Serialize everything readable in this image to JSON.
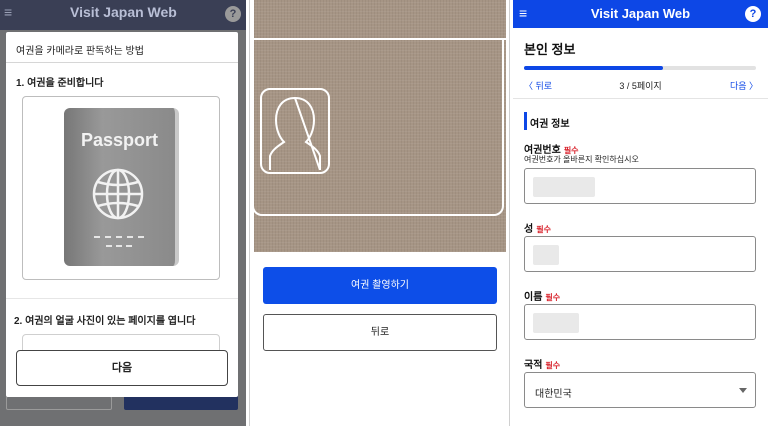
{
  "panel1": {
    "bg_header_title": "Visit Japan Web",
    "bg_menu_icon": "≡",
    "bg_help_icon": "?",
    "modal_title": "여권을 카메라로 판독하는 방법",
    "step1": "1. 여권을 준비합니다",
    "passport_text": "Passport",
    "step2": "2. 여권의 얼굴 사진이 있는 페이지를 엽니다",
    "next_button": "다음"
  },
  "panel2": {
    "shoot_button": "여권 촬영하기",
    "back_button": "뒤로"
  },
  "panel3": {
    "header_title": "Visit Japan Web",
    "menu_icon": "≡",
    "help_icon": "?",
    "section_title": "본인 정보",
    "progress": 0.6,
    "prev_link": "〈 뒤로",
    "page_indicator": "3 / 5페이지",
    "next_link": "다음 〉",
    "group_label": "여권 정보",
    "required": "필수",
    "passport_number_label": "여권번호",
    "passport_number_hint": "여권번호가 올바른지 확인하십시오",
    "surname_label": "성",
    "given_name_label": "이름",
    "nationality_label": "국적",
    "nationality_value": "대한민국"
  },
  "colors": {
    "primary_blue": "#0d47e6",
    "required_red": "#d8202a",
    "dim_header": "#3a3f55"
  }
}
